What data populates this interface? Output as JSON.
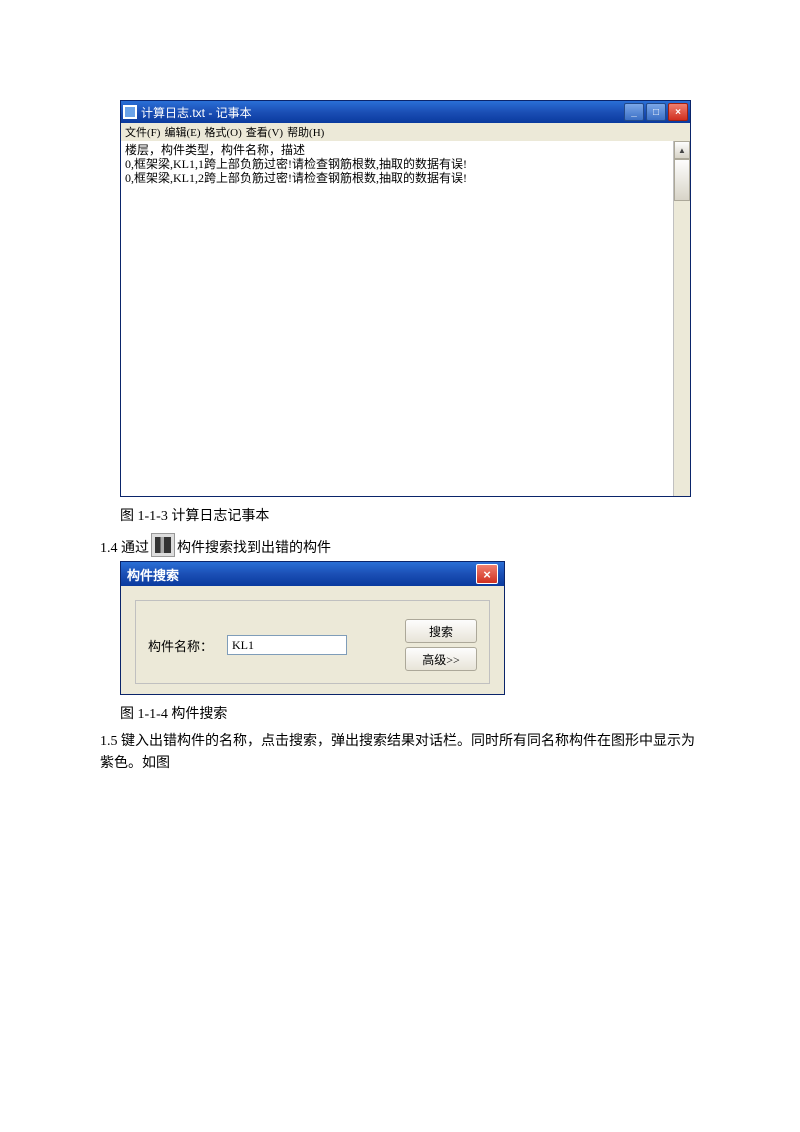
{
  "notepad": {
    "title": "计算日志.txt - 记事本",
    "menus": [
      "文件(F)",
      "编辑(E)",
      "格式(O)",
      "查看(V)",
      "帮助(H)"
    ],
    "content": "楼层，构件类型，构件名称，描述\n0,框架梁,KL1,1跨上部负筋过密!请检查钢筋根数,抽取的数据有误!\n0,框架梁,KL1,2跨上部负筋过密!请检查钢筋根数,抽取的数据有误!",
    "min": "_",
    "max": "□",
    "close": "×"
  },
  "cap1": "图 1-1-3 计算日志记事本",
  "para14_a": "1.4 通过",
  "para14_b": "构件搜索找到出错的构件",
  "dialog": {
    "title": "构件搜索",
    "close": "×",
    "label": "构件名称：",
    "value": "KL1",
    "search": "搜索",
    "advanced": "高级>>"
  },
  "cap2": "图 1-1-4 构件搜索",
  "para15": "1.5 键入出错构件的名称，点击搜索，弹出搜索结果对话栏。同时所有同名称构件在图形中显示为紫色。如图"
}
